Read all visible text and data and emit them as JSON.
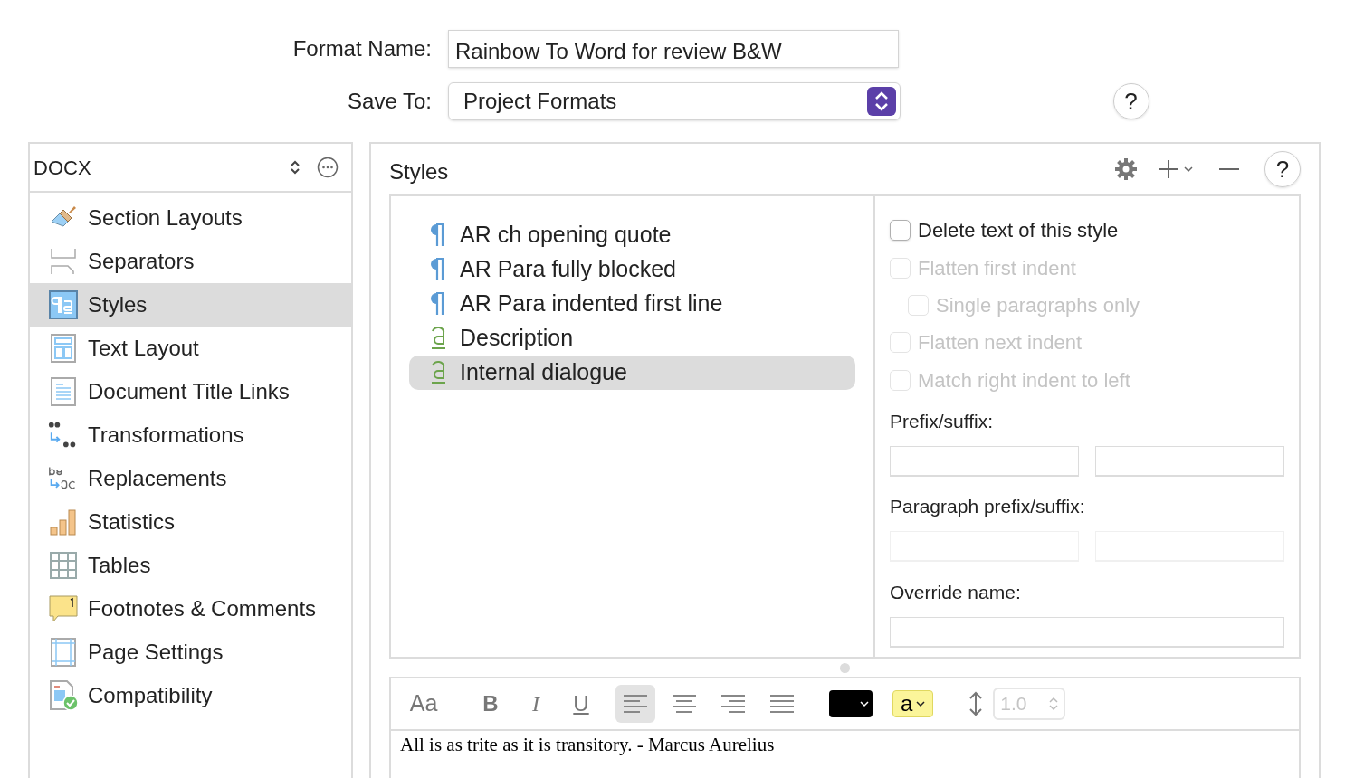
{
  "format_name": {
    "label": "Format Name:",
    "value": "Rainbow To Word for review B&W"
  },
  "save_to": {
    "label": "Save To:",
    "value": "Project Formats"
  },
  "top_help": "?",
  "sidebar": {
    "format": "DOCX",
    "items": [
      {
        "label": "Section Layouts",
        "kind": "brush",
        "selected": false
      },
      {
        "label": "Separators",
        "kind": "separators",
        "selected": false
      },
      {
        "label": "Styles",
        "kind": "styles",
        "selected": true
      },
      {
        "label": "Text Layout",
        "kind": "layout",
        "selected": false
      },
      {
        "label": "Document Title Links",
        "kind": "document",
        "selected": false
      },
      {
        "label": "Transformations",
        "kind": "quotes",
        "selected": false
      },
      {
        "label": "Replacements",
        "kind": "replace",
        "selected": false
      },
      {
        "label": "Statistics",
        "kind": "bars",
        "selected": false
      },
      {
        "label": "Tables",
        "kind": "grid",
        "selected": false
      },
      {
        "label": "Footnotes & Comments",
        "kind": "note",
        "selected": false
      },
      {
        "label": "Page Settings",
        "kind": "page",
        "selected": false
      },
      {
        "label": "Compatibility",
        "kind": "check",
        "selected": false
      }
    ]
  },
  "styles": {
    "title": "Styles",
    "help": "?",
    "items": [
      {
        "name": "AR ch opening quote",
        "kind": "paragraph",
        "selected": false
      },
      {
        "name": "AR Para fully blocked",
        "kind": "paragraph",
        "selected": false
      },
      {
        "name": "AR Para indented first line",
        "kind": "paragraph",
        "selected": false
      },
      {
        "name": "Description",
        "kind": "character",
        "selected": false
      },
      {
        "name": "Internal dialogue",
        "kind": "character",
        "selected": true
      }
    ],
    "options": [
      {
        "label": "Delete text of this style",
        "checked": false,
        "disabled": false
      },
      {
        "label": "Flatten first indent",
        "checked": false,
        "disabled": true,
        "children": [
          {
            "label": "Single paragraphs only",
            "checked": false,
            "disabled": true
          }
        ]
      },
      {
        "label": "Flatten next indent",
        "checked": false,
        "disabled": true
      },
      {
        "label": "Match right indent to left",
        "checked": false,
        "disabled": true
      }
    ],
    "field_groups": [
      {
        "label": "Prefix/suffix:",
        "fields": [
          {
            "disabled": false
          },
          {
            "disabled": false
          }
        ]
      },
      {
        "label": "Paragraph prefix/suffix:",
        "fields": [
          {
            "disabled": true
          },
          {
            "disabled": true
          }
        ]
      },
      {
        "label": "Override name:",
        "fields": [
          {
            "disabled": false
          }
        ]
      }
    ]
  },
  "toolbar": {
    "font": "Aa",
    "bold": "B",
    "italic": "I",
    "underline": "U",
    "alignments": [
      {
        "selected": true
      },
      {
        "selected": false
      },
      {
        "selected": false
      },
      {
        "selected": false
      }
    ],
    "highlight": "a",
    "line_spacing": "1.0"
  },
  "preview_text": "All is as trite as it is transitory. - Marcus Aurelius"
}
